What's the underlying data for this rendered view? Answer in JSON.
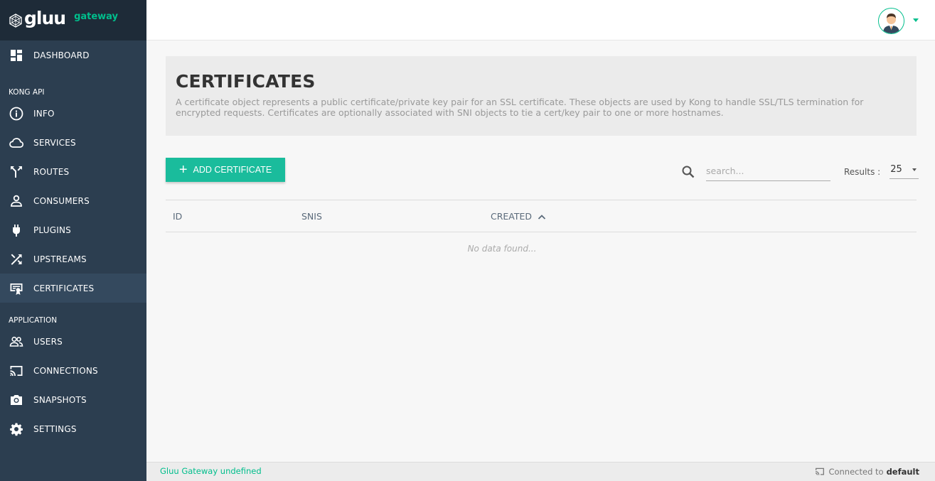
{
  "brand": {
    "name": "gluu",
    "sub": "gateway"
  },
  "sidebar": {
    "top_items": [
      {
        "label": "DASHBOARD",
        "icon": "dashboard-icon"
      }
    ],
    "section_kong": "KONG API",
    "kong_items": [
      {
        "label": "INFO",
        "icon": "info-icon"
      },
      {
        "label": "SERVICES",
        "icon": "cloud-icon"
      },
      {
        "label": "ROUTES",
        "icon": "routes-icon"
      },
      {
        "label": "CONSUMERS",
        "icon": "person-icon"
      },
      {
        "label": "PLUGINS",
        "icon": "plug-icon"
      },
      {
        "label": "UPSTREAMS",
        "icon": "shuffle-icon"
      },
      {
        "label": "CERTIFICATES",
        "icon": "certificate-icon",
        "active": true
      }
    ],
    "section_app": "APPLICATION",
    "app_items": [
      {
        "label": "USERS",
        "icon": "users-icon"
      },
      {
        "label": "CONNECTIONS",
        "icon": "cast-icon"
      },
      {
        "label": "SNAPSHOTS",
        "icon": "camera-icon"
      },
      {
        "label": "SETTINGS",
        "icon": "gear-icon"
      }
    ]
  },
  "header": {
    "title": "CERTIFICATES",
    "description": "A certificate object represents a public certificate/private key pair for an SSL certificate. These objects are used by Kong to handle SSL/TLS termination for encrypted requests. Certificates are optionally associated with SNI objects to tie a cert/key pair to one or more hostnames."
  },
  "toolbar": {
    "add_label": "ADD CERTIFICATE",
    "search_placeholder": "search...",
    "results_label": "Results :",
    "results_value": "25"
  },
  "table": {
    "columns": [
      "ID",
      "SNIS",
      "CREATED"
    ],
    "empty_text": "No data found..."
  },
  "footer": {
    "version": "Gluu Gateway undefined",
    "connected_prefix": "Connected to",
    "connected_name": "default"
  },
  "colors": {
    "accent": "#1abc9c",
    "sidebar": "#2c3e50",
    "brand_green": "#00be8c"
  }
}
